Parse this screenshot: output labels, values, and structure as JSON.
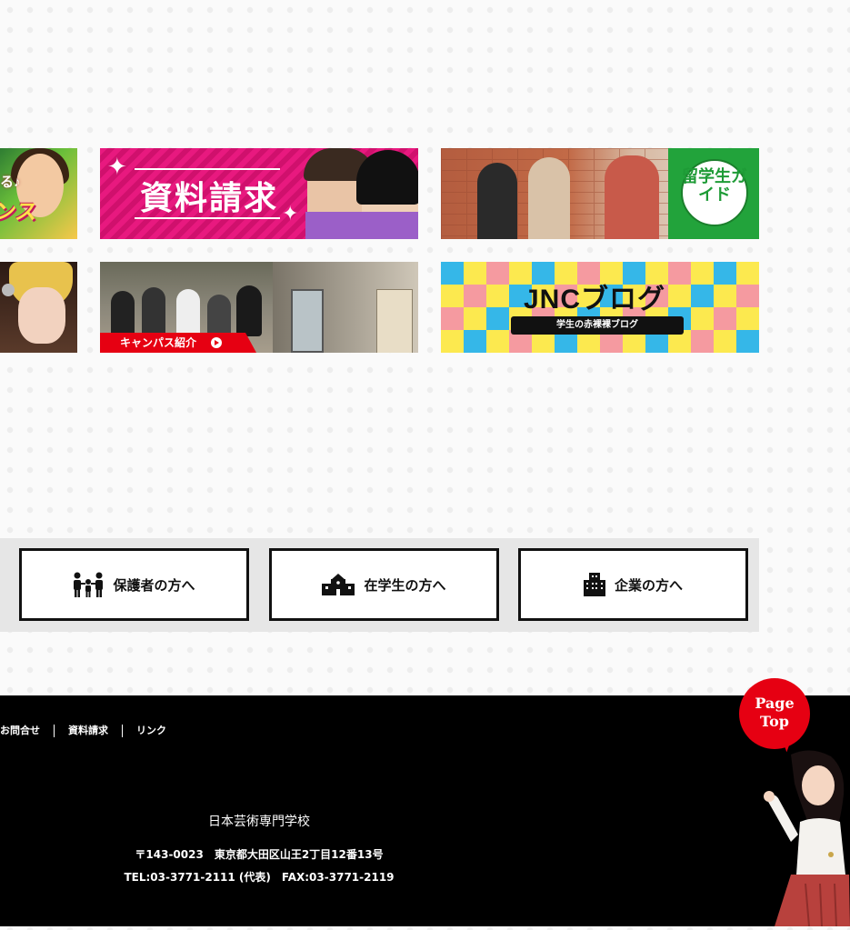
{
  "banners": {
    "dance": {
      "line1": "る♪",
      "line2": "ンス"
    },
    "request": {
      "title": "資料請求"
    },
    "international": {
      "badge": "留学生ガイド"
    },
    "campus": {
      "tag": "キャンパス紹介"
    },
    "blog": {
      "title": "JNCブログ",
      "subtitle": "学生の赤裸裸ブログ"
    }
  },
  "audience": {
    "parents": {
      "label": "保護者の方へ",
      "icon": "family-icon"
    },
    "students": {
      "label": "在学生の方へ",
      "icon": "school-building-icon"
    },
    "companies": {
      "label": "企業の方へ",
      "icon": "office-building-icon"
    }
  },
  "footer": {
    "nav": [
      "お問合せ",
      "資料請求",
      "リンク"
    ],
    "school_name": "日本芸術専門学校",
    "address": "〒143-0023　東京都大田区山王2丁目12番13号",
    "contact": "TEL:03-3771-2111 (代表)　FAX:03-3771-2119"
  },
  "page_top": {
    "line1": "Page",
    "line2": "Top"
  },
  "colors": {
    "accent_red": "#e60012",
    "pink": "#e8197f",
    "green": "#22a33b"
  }
}
